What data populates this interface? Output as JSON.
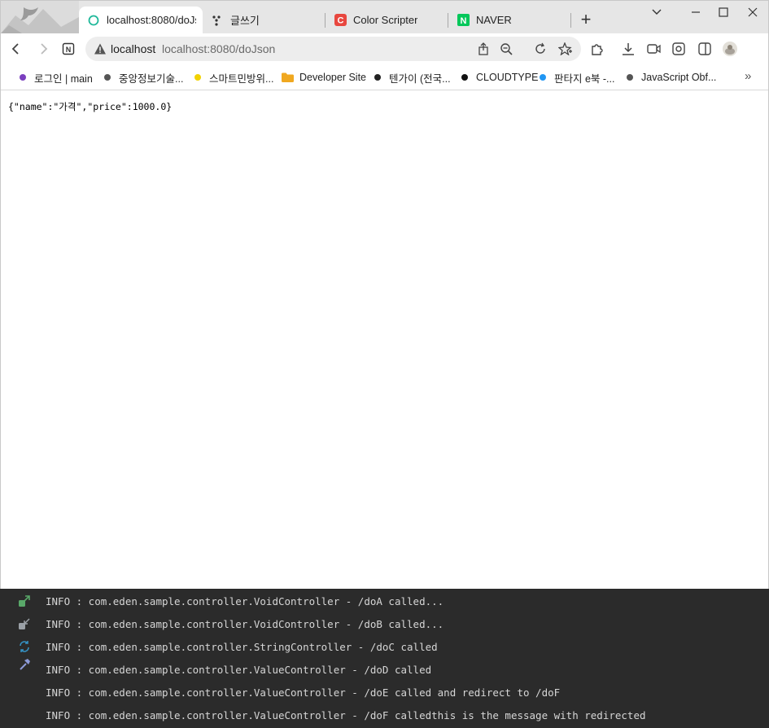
{
  "browser": {
    "tabs": [
      {
        "label": "localhost:8080/doJs",
        "icon": "loading-ring-icon",
        "active": true
      },
      {
        "label": "글쓰기",
        "icon": "dots-grid-icon",
        "active": false
      },
      {
        "label": "Color Scripter",
        "icon": "color-scripter-icon",
        "active": false
      },
      {
        "label": "NAVER",
        "icon": "naver-icon",
        "active": false
      }
    ],
    "new_tab_label": "+",
    "address": {
      "host": "localhost",
      "url": "localhost:8080/doJson"
    },
    "bookmarks": [
      {
        "label": "로그인 | main",
        "color": "#7b3fbf"
      },
      {
        "label": "중앙정보기술...",
        "color": "#555555"
      },
      {
        "label": "스마트민방위...",
        "color": "#f2d200"
      },
      {
        "label": "Developer Site",
        "color": "#f0a820",
        "folder": true
      },
      {
        "label": "텐가이 (전국...",
        "color": "#222222"
      },
      {
        "label": "CLOUDTYPE",
        "color": "#111111"
      },
      {
        "label": "판타지 e북 -...",
        "color": "#2196f3"
      },
      {
        "label": "JavaScript Obf...",
        "color": "#555555"
      }
    ],
    "bookmarks_more": "»"
  },
  "page": {
    "json_text": "{\"name\":\"가격\",\"price\":1000.0}"
  },
  "console": {
    "lines": [
      "INFO : com.eden.sample.controller.VoidController - /doA called...",
      "INFO : com.eden.sample.controller.VoidController - /doB called...",
      "INFO : com.eden.sample.controller.StringController - /doC called",
      "INFO : com.eden.sample.controller.ValueController - /doD called",
      "INFO : com.eden.sample.controller.ValueController - /doE called and redirect to /doF",
      "INFO : com.eden.sample.controller.ValueController - /doF calledthis is the message with redirected"
    ]
  }
}
